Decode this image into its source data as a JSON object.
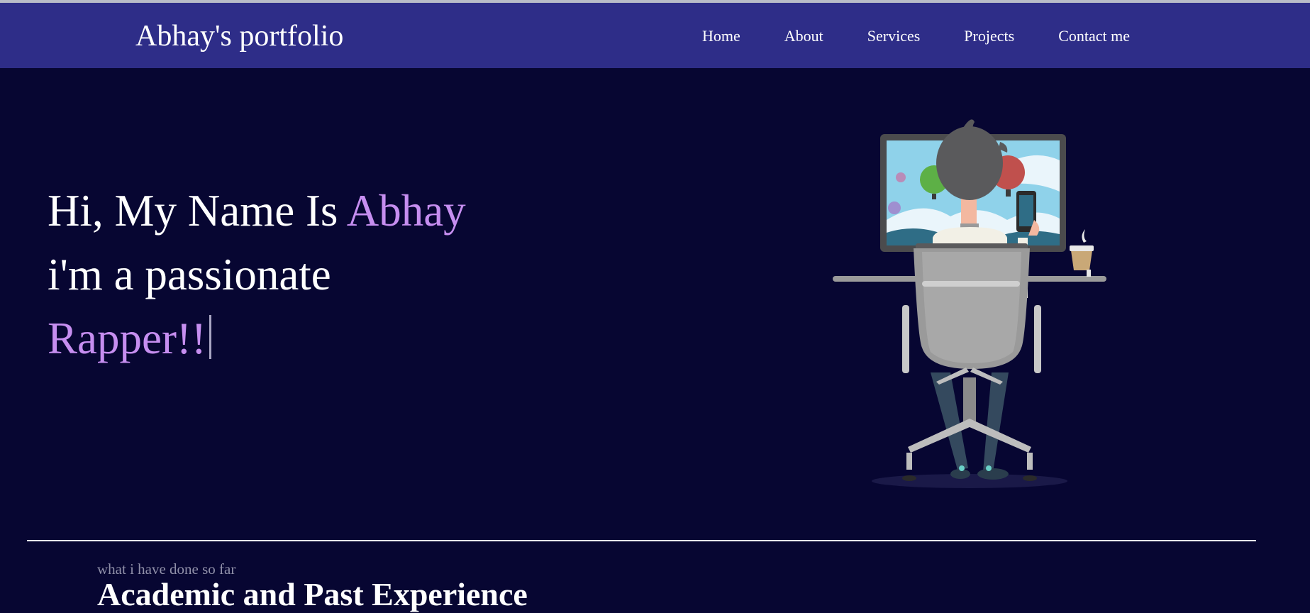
{
  "navbar": {
    "brand": "Abhay's portfolio",
    "links": [
      "Home",
      "About",
      "Services",
      "Projects",
      "Contact me"
    ]
  },
  "hero": {
    "line1_prefix": "Hi, My Name Is ",
    "line1_name": "Abhay",
    "line2": "i'm a passionate",
    "line3_typed": "Rapper!!"
  },
  "section": {
    "subtitle": "what i have done so far",
    "title": "Academic and Past Experience"
  },
  "colors": {
    "navbar_bg": "#2e2d88",
    "page_bg": "#070632",
    "accent": "#c68ef0"
  },
  "illustration": {
    "icon": "person-at-desk-illustration"
  }
}
